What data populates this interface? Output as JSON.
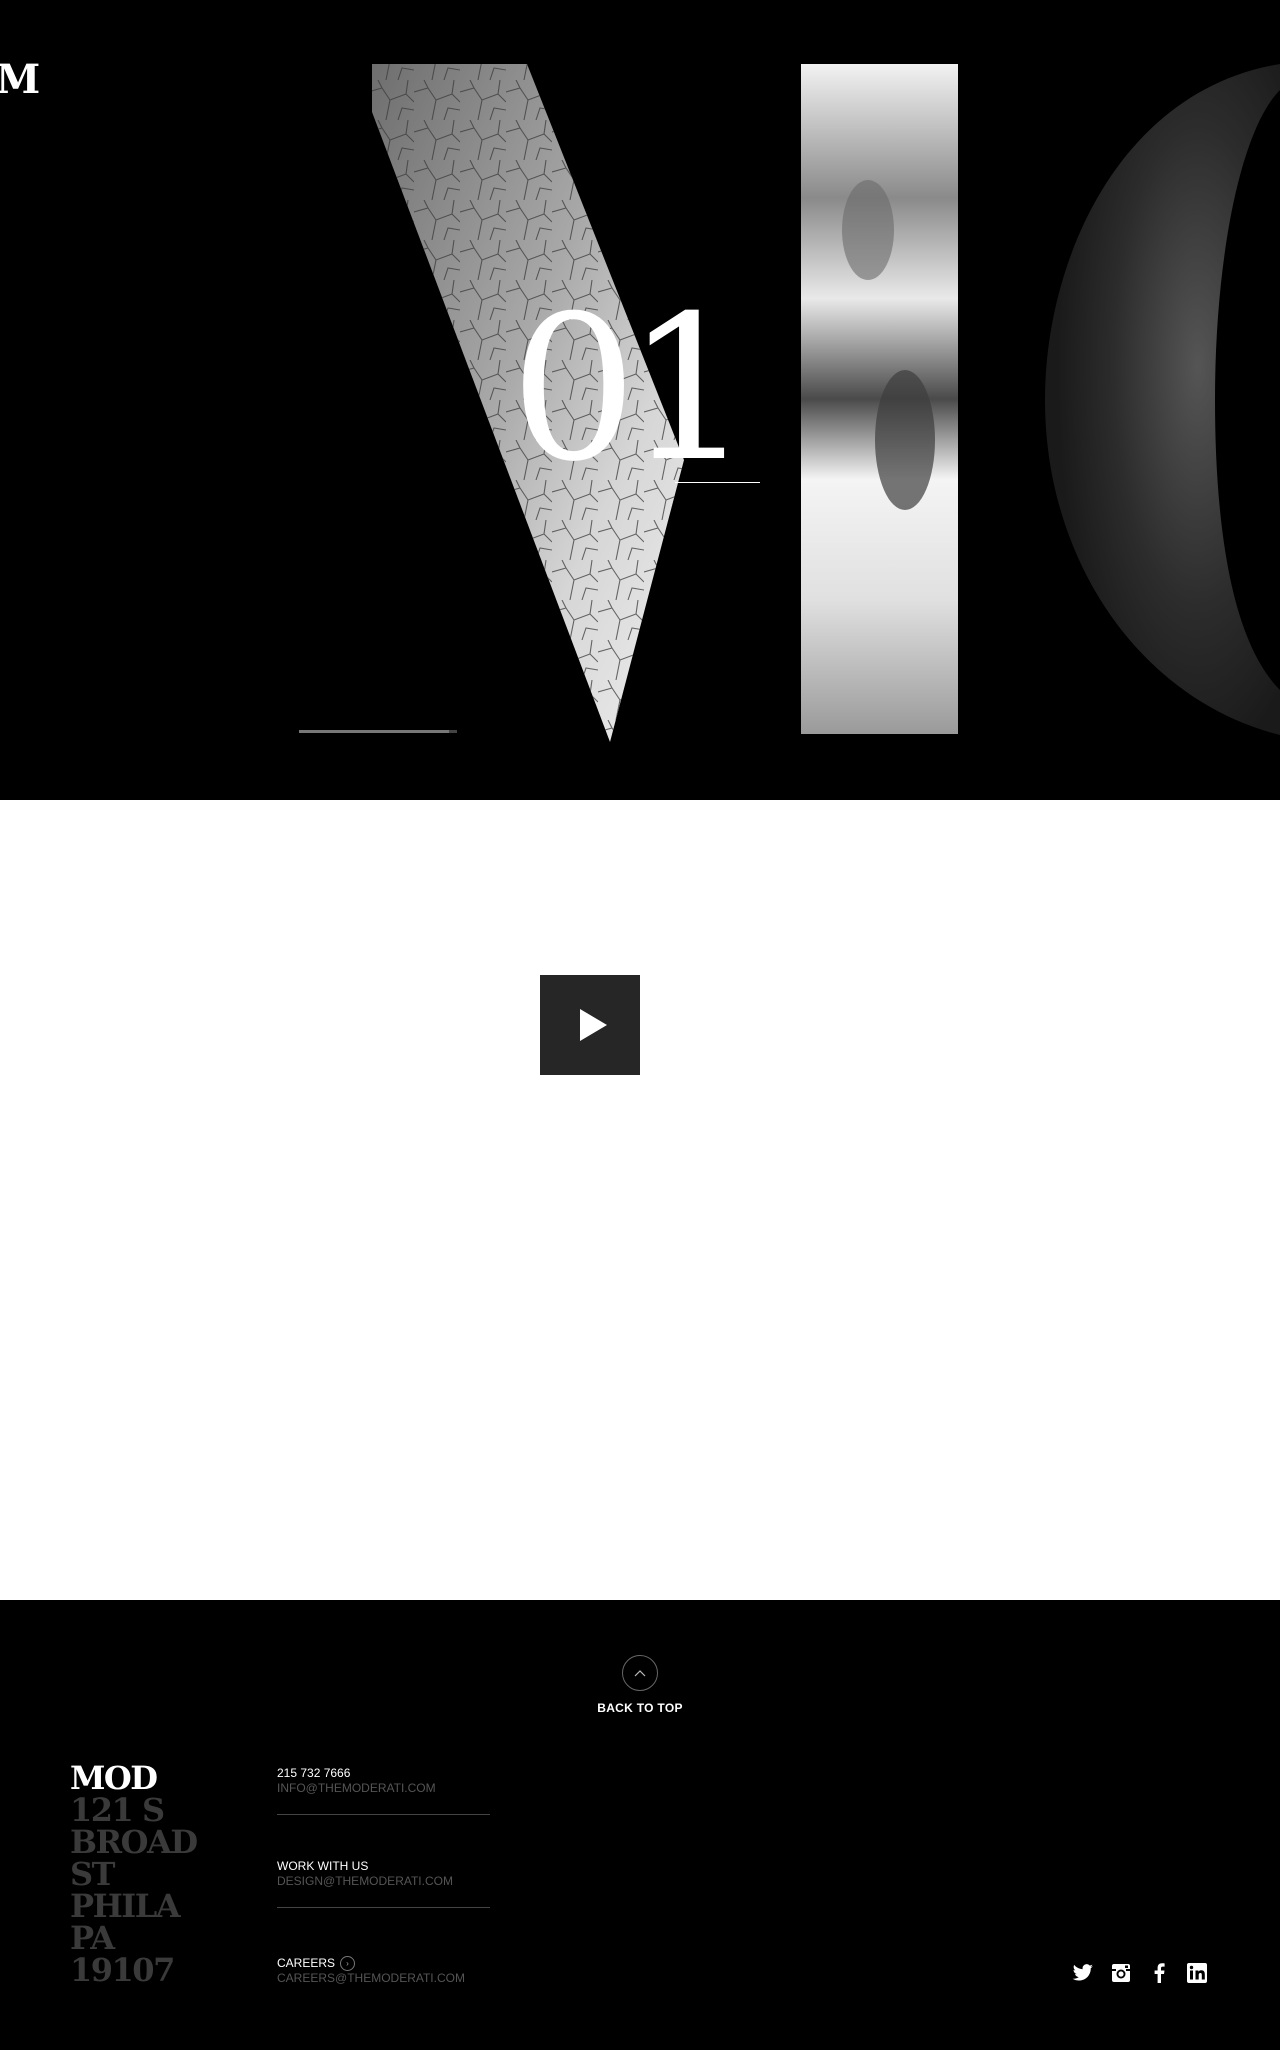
{
  "hero": {
    "logo": "M",
    "slide_number": "01",
    "slide_progress": 0.95
  },
  "video": {
    "play_icon": "play-icon"
  },
  "footer": {
    "back_to_top": "BACK TO TOP",
    "address": {
      "brand": "MOD",
      "lines": [
        "121 S",
        "BROAD",
        "ST",
        "PHILA",
        "PA",
        "19107"
      ]
    },
    "contacts": [
      {
        "title": "215 732 7666",
        "email": "INFO@THEMODERATI.COM"
      },
      {
        "title": "WORK WITH US",
        "email": "DESIGN@THEMODERATI.COM"
      },
      {
        "title": "CAREERS",
        "email": "CAREERS@THEMODERATI.COM"
      }
    ],
    "social_icons": [
      "twitter-icon",
      "instagram-icon",
      "facebook-icon",
      "linkedin-icon"
    ]
  },
  "colors": {
    "background": "#000000",
    "video_bg": "#ffffff",
    "play_button": "#262626",
    "muted_text": "#555555"
  }
}
